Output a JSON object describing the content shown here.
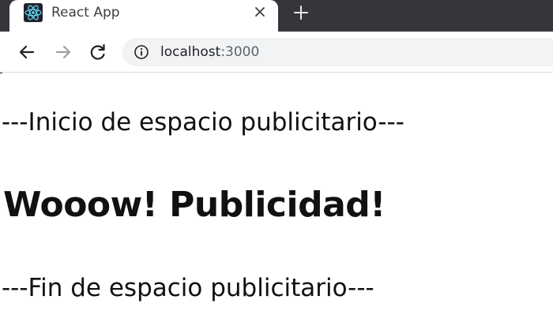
{
  "tab": {
    "title": "React App",
    "favicon_icon": "react-logo-icon",
    "close_icon": "close-icon",
    "new_tab_icon": "plus-icon"
  },
  "toolbar": {
    "back_icon": "arrow-left-icon",
    "forward_icon": "arrow-right-icon",
    "reload_icon": "reload-icon",
    "info_icon": "info-icon",
    "url_host": "localhost",
    "url_port": ":3000"
  },
  "page": {
    "ad_start": "---Inicio de espacio publicitario---",
    "ad_headline": "Wooow! Publicidad!",
    "ad_end": "---Fin de espacio publicitario---"
  },
  "colors": {
    "tabstrip": "#35363a",
    "react_blue": "#61dafb",
    "omnibox": "#f1f3f4"
  }
}
